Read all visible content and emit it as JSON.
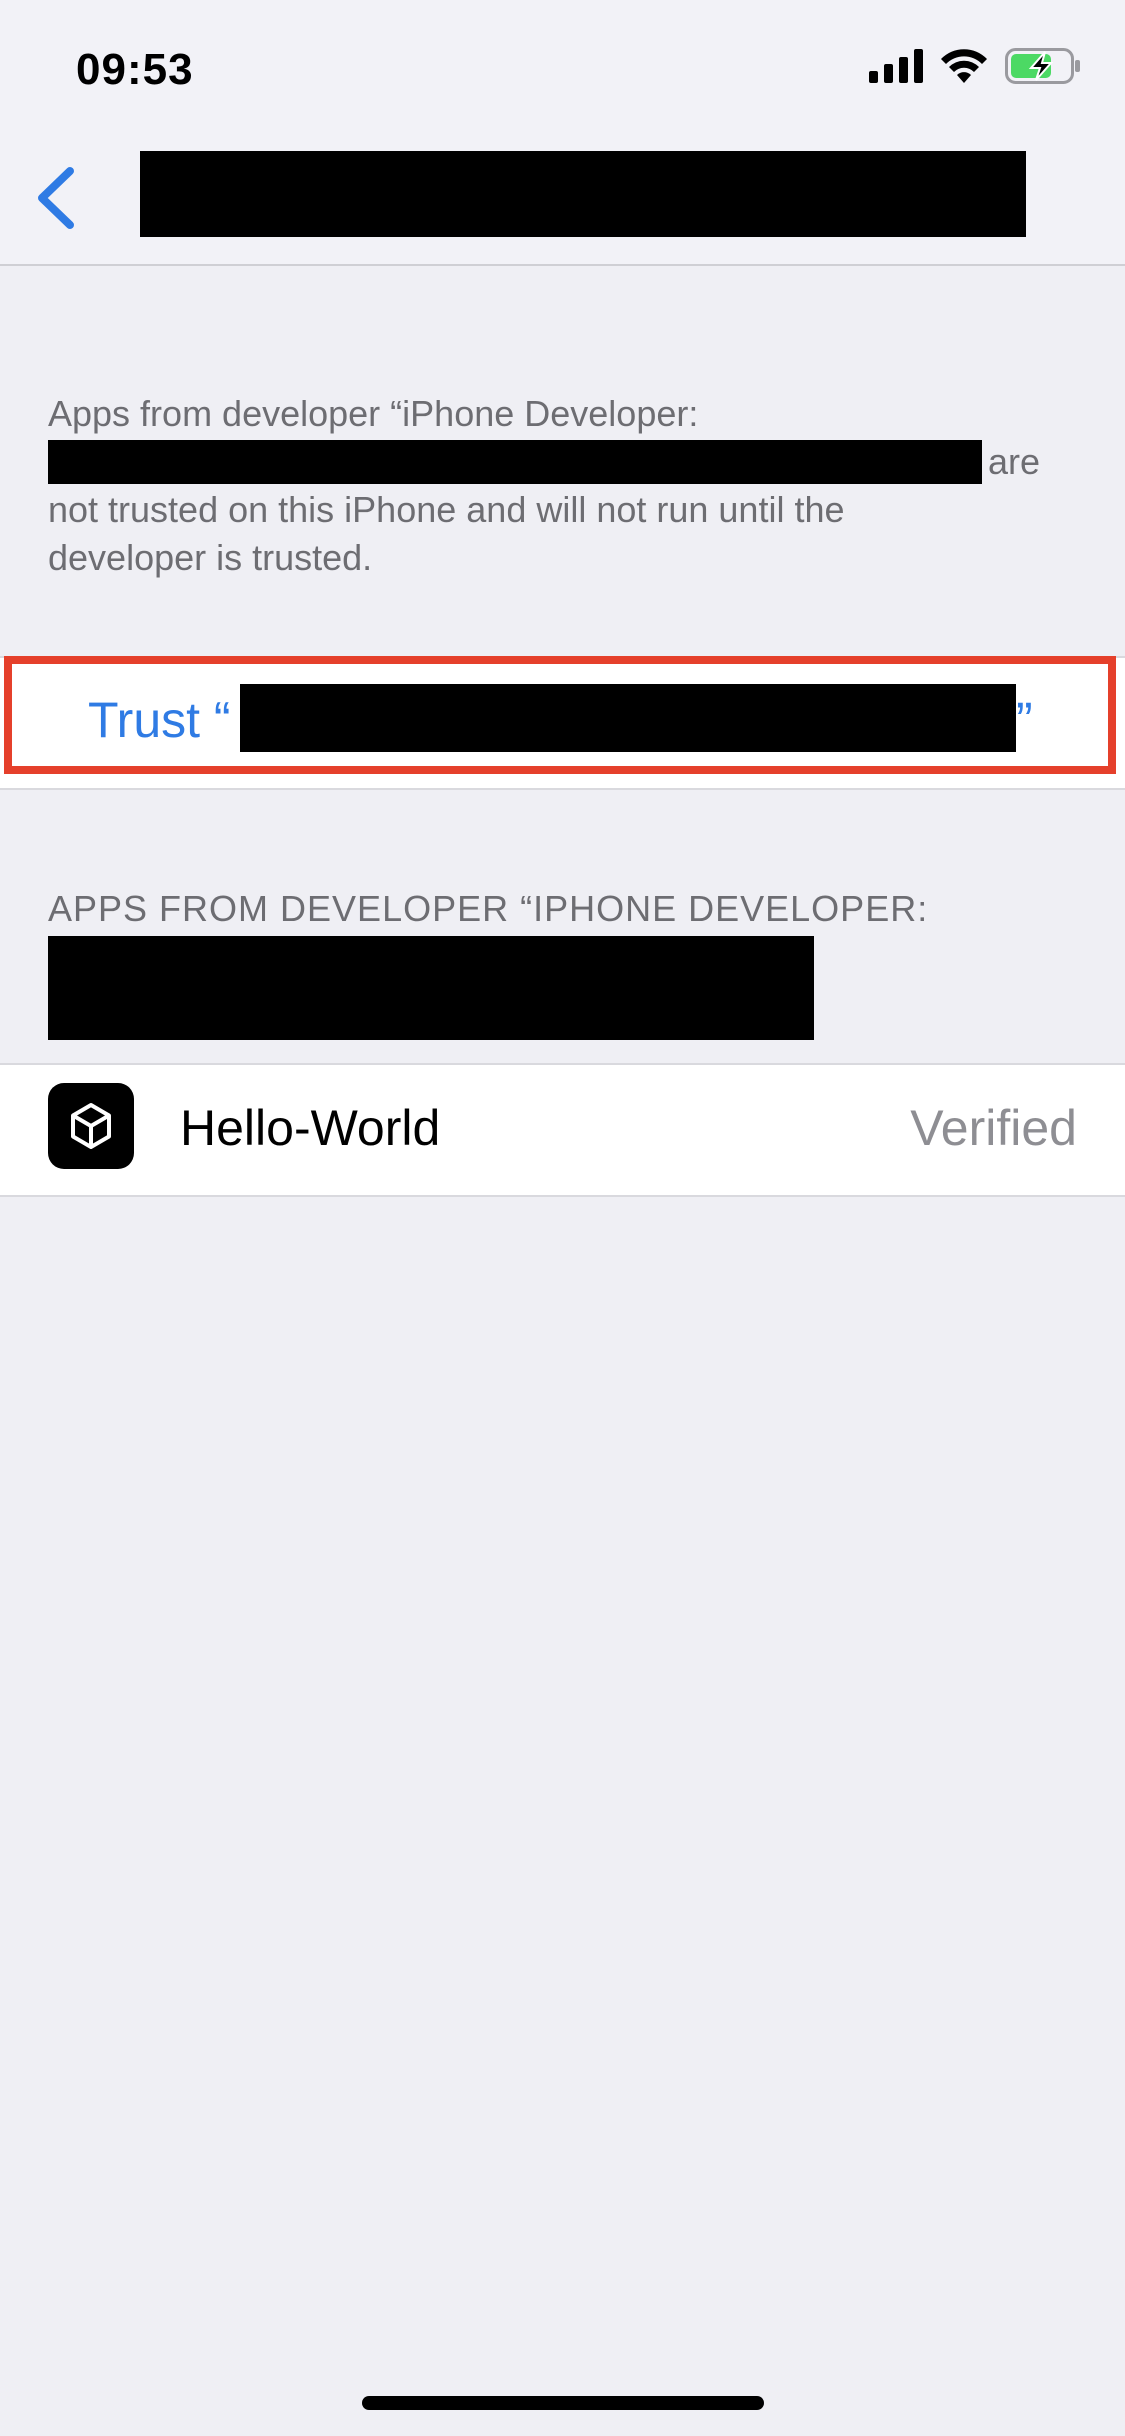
{
  "status_bar": {
    "time": "09:53",
    "icons": [
      "cellular-signal-icon",
      "wifi-icon",
      "battery-charging-icon"
    ],
    "battery_color": "#4cd964"
  },
  "nav": {
    "back_icon": "chevron-left-icon",
    "accent": "#2f7be4"
  },
  "description": {
    "line1": "Apps from developer “iPhone Developer:",
    "line2_suffix": "are",
    "line3": "not trusted on this iPhone and will not run until the",
    "line4": "developer is trusted."
  },
  "trust": {
    "prefix": "Trust “",
    "suffix": "”",
    "highlight_color": "#e5402b"
  },
  "apps_section": {
    "header": "APPS FROM DEVELOPER “IPHONE DEVELOPER:",
    "apps": [
      {
        "name": "Hello-World",
        "status": "Verified",
        "icon": "unity-icon"
      }
    ]
  }
}
